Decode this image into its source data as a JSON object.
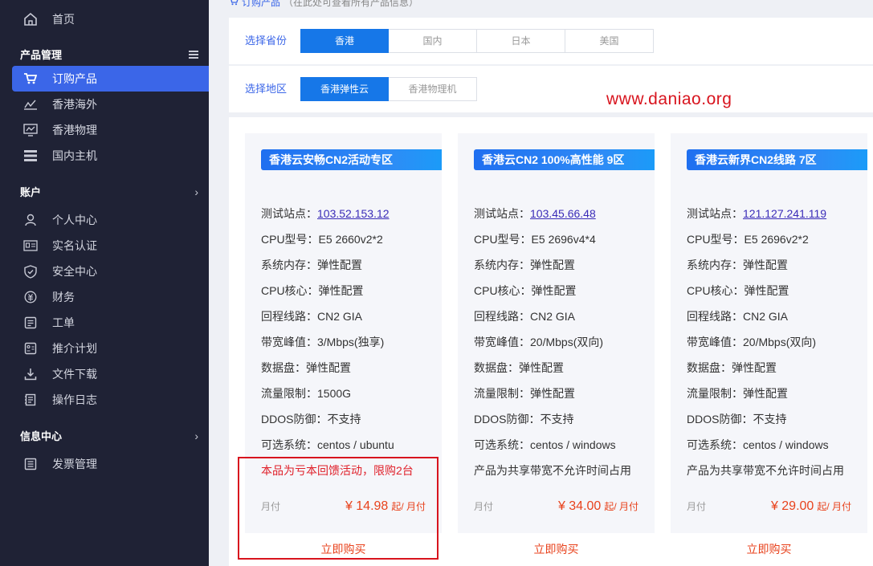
{
  "sidebar": {
    "home": "首页",
    "product_section": "产品管理",
    "product_items": [
      {
        "label": "订购产品",
        "icon": "cart-icon"
      },
      {
        "label": "香港海外",
        "icon": "chart-icon"
      },
      {
        "label": "香港物理",
        "icon": "monitor-chart-icon"
      },
      {
        "label": "国内主机",
        "icon": "server-icon"
      }
    ],
    "account_section": "账户",
    "account_items": [
      {
        "label": "个人中心",
        "icon": "user-icon"
      },
      {
        "label": "实名认证",
        "icon": "id-card-icon"
      },
      {
        "label": "安全中心",
        "icon": "shield-icon"
      },
      {
        "label": "财务",
        "icon": "money-icon"
      },
      {
        "label": "工单",
        "icon": "ticket-icon"
      },
      {
        "label": "推介计划",
        "icon": "referral-icon"
      },
      {
        "label": "文件下载",
        "icon": "download-icon"
      },
      {
        "label": "操作日志",
        "icon": "log-icon"
      }
    ],
    "info_section": "信息中心",
    "info_items": [
      {
        "label": "发票管理",
        "icon": "invoice-icon"
      }
    ],
    "menu_icon": "hamburger-icon",
    "chevron_icon": "chevron-right-icon"
  },
  "breadcrumb": {
    "link": "订购产品",
    "hint": "（在此处可查看所有产品信息）"
  },
  "filters": {
    "province_label": "选择省份",
    "provinces": [
      "香港",
      "国内",
      "日本",
      "美国"
    ],
    "province_active": 0,
    "region_label": "选择地区",
    "regions": [
      "香港弹性云",
      "香港物理机"
    ],
    "region_active": 0
  },
  "watermark": "www.daniao.org",
  "products": [
    {
      "title": "香港云安畅CN2活动专区",
      "specs": {
        "test_label": "测试站点：",
        "test_ip": "103.52.153.12",
        "cpu_model": "CPU型号：E5 2660v2*2",
        "memory": "系统内存：弹性配置",
        "cpu_cores": "CPU核心：弹性配置",
        "route": "回程线路：CN2 GIA",
        "bandwidth": "带宽峰值：3/Mbps(独享)",
        "disk": "数据盘：弹性配置",
        "traffic": "流量限制：1500G",
        "ddos": "DDOS防御：不支持",
        "os": "可选系统：centos / ubuntu"
      },
      "note": "本品为亏本回馈活动，限购2台",
      "cycle": "月付",
      "price": "¥ 14.98",
      "unit": "起/ 月付",
      "buy": "立即购买"
    },
    {
      "title": "香港云CN2 100%高性能 9区",
      "specs": {
        "test_label": "测试站点：",
        "test_ip": "103.45.66.48",
        "cpu_model": "CPU型号：E5 2696v4*4",
        "memory": "系统内存：弹性配置",
        "cpu_cores": "CPU核心：弹性配置",
        "route": "回程线路：CN2 GIA",
        "bandwidth": "带宽峰值：20/Mbps(双向)",
        "disk": "数据盘：弹性配置",
        "traffic": "流量限制：弹性配置",
        "ddos": "DDOS防御：不支持",
        "os": "可选系统：centos / windows"
      },
      "note": "产品为共享带宽不允许时间占用",
      "cycle": "月付",
      "price": "¥ 34.00",
      "unit": "起/ 月付",
      "buy": "立即购买"
    },
    {
      "title": "香港云新界CN2线路 7区",
      "specs": {
        "test_label": "测试站点：",
        "test_ip": "121.127.241.119",
        "cpu_model": "CPU型号：E5 2696v2*2",
        "memory": "系统内存：弹性配置",
        "cpu_cores": "CPU核心：弹性配置",
        "route": "回程线路：CN2 GIA",
        "bandwidth": "带宽峰值：20/Mbps(双向)",
        "disk": "数据盘：弹性配置",
        "traffic": "流量限制：弹性配置",
        "ddos": "DDOS防御：不支持",
        "os": "可选系统：centos / windows"
      },
      "note": "产品为共享带宽不允许时间占用",
      "cycle": "月付",
      "price": "¥ 29.00",
      "unit": "起/ 月付",
      "buy": "立即购买"
    }
  ],
  "colors": {
    "accent": "#3b66e8",
    "sidebar_bg": "#1f2235",
    "price": "#e8421c",
    "highlight": "#d8141e"
  }
}
